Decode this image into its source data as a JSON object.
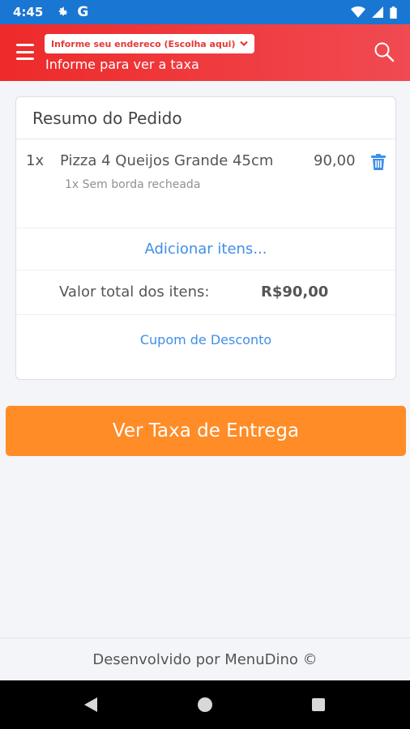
{
  "status_bar": {
    "time": "4:45",
    "left_icons": [
      "settings-gear-icon",
      "google-g-icon"
    ],
    "google_letter": "G",
    "right_icons": [
      "wifi-icon",
      "signal-icon",
      "battery-icon"
    ],
    "background_color": "#1976d2"
  },
  "header": {
    "menu_icon": "hamburger-menu-icon",
    "address_button_label": "Informe seu endereco (Escolha aqui)",
    "address_chevron_icon": "chevron-down-icon",
    "address_subtitle": "Informe para ver a taxa",
    "search_icon": "search-icon",
    "background_color": "#ee2a2a"
  },
  "order_summary": {
    "title": "Resumo do Pedido",
    "items": [
      {
        "quantity": "1x",
        "name": "Pizza 4 Queijos Grande 45cm",
        "price": "90,00",
        "option": "1x Sem borda recheada",
        "delete_icon": "trash-icon"
      }
    ],
    "add_items_label": "Adicionar itens...",
    "total_label": "Valor total dos itens:",
    "total_value": "R$90,00",
    "coupon_label": "Cupom de Desconto",
    "link_color": "#3f8ee8"
  },
  "cta": {
    "label": "Ver Taxa de Entrega",
    "color": "#ff8c26"
  },
  "footer": {
    "text": "Desenvolvido por MenuDino ©"
  },
  "nav_bar": {
    "icons": [
      "back-triangle-icon",
      "home-circle-icon",
      "recents-square-icon"
    ]
  }
}
